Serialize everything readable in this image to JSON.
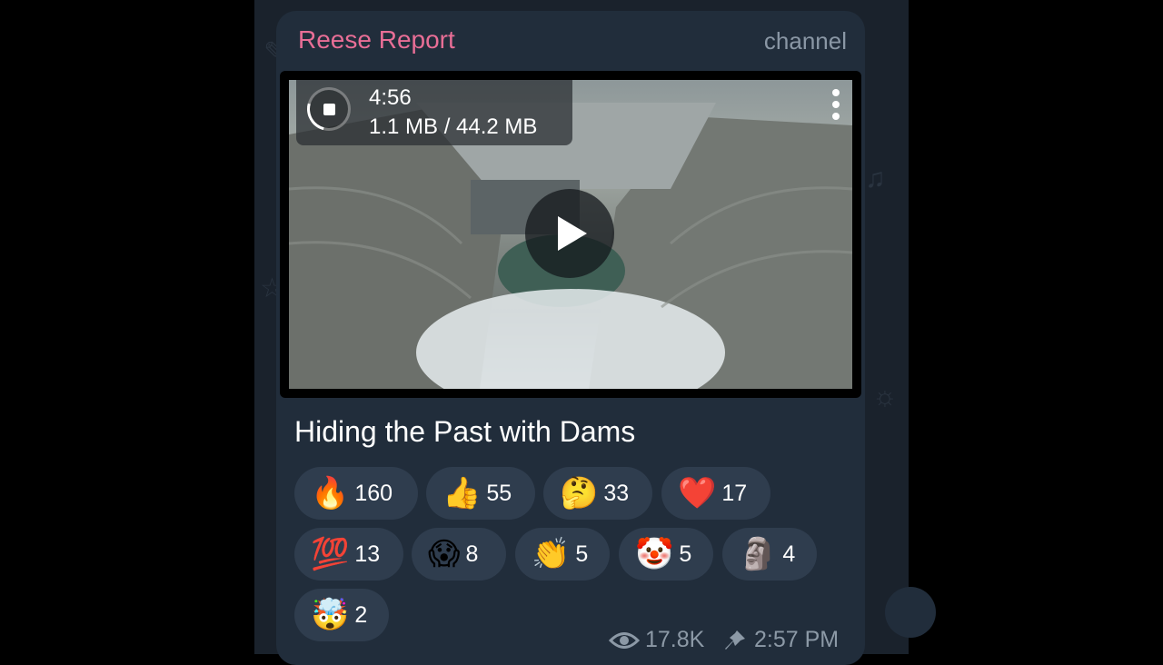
{
  "header": {
    "channel_name": "Reese Report",
    "channel_label": "channel"
  },
  "video": {
    "duration": "4:56",
    "size": "1.1 MB / 44.2 MB"
  },
  "caption": "Hiding the Past with Dams",
  "reactions": [
    {
      "emoji": "🔥",
      "count": "160"
    },
    {
      "emoji": "👍",
      "count": "55"
    },
    {
      "emoji": "🤔",
      "count": "33"
    },
    {
      "emoji": "❤️",
      "count": "17"
    },
    {
      "emoji": "💯",
      "count": "13"
    },
    {
      "emoji": "😱",
      "count": "8"
    },
    {
      "emoji": "👏",
      "count": "5"
    },
    {
      "emoji": "🤡",
      "count": "5"
    },
    {
      "emoji": "🗿",
      "count": "4"
    },
    {
      "emoji": "🤯",
      "count": "2"
    }
  ],
  "meta": {
    "views": "17.8K",
    "time": "2:57 PM"
  },
  "icons": {
    "play": "play-icon",
    "stop": "stop-icon",
    "menu": "more-vertical-icon",
    "views": "eye-icon",
    "pinned": "pin-icon"
  },
  "colors": {
    "channel_name": "#e86e96",
    "bubble": "#212d3b",
    "reaction_pill": "#2f3d4e",
    "meta_text": "#8c99a6"
  }
}
